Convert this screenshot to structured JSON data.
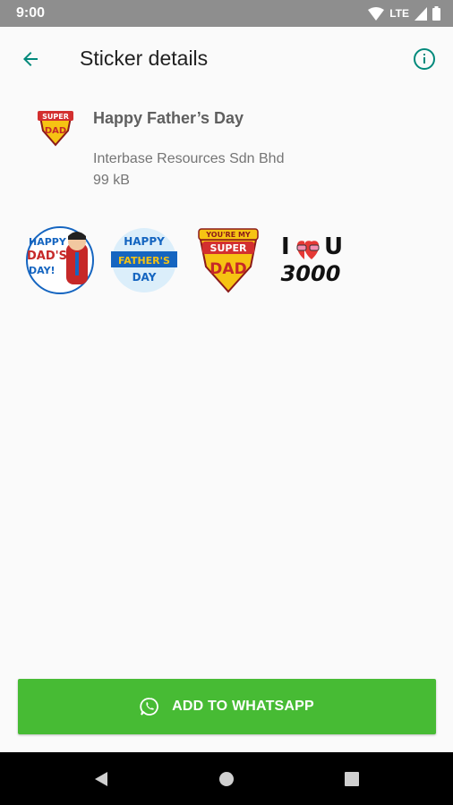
{
  "status_bar": {
    "time": "9:00",
    "network": "LTE"
  },
  "app_bar": {
    "title": "Sticker details",
    "back_icon": "arrow-back-icon",
    "info_icon": "info-icon"
  },
  "pack": {
    "title": "Happy Father’s Day",
    "publisher": "Interbase Resources Sdn Bhd",
    "size": "99 kB",
    "icon_text": [
      "SUPER",
      "DAD"
    ]
  },
  "stickers": [
    {
      "lines": [
        "HAPPY",
        "DAD'S",
        "DAY!"
      ]
    },
    {
      "lines": [
        "HAPPY",
        "FATHER'S",
        "DAY"
      ]
    },
    {
      "lines": [
        "YOU'RE MY",
        "SUPER",
        "DAD"
      ]
    },
    {
      "lines": [
        "I",
        "U",
        "3000"
      ]
    }
  ],
  "add_button": {
    "label": "ADD TO WHATSAPP",
    "icon": "whatsapp-icon"
  },
  "nav_bar": {
    "back": "back-triangle-icon",
    "home": "home-circle-icon",
    "recents": "recents-square-icon"
  },
  "colors": {
    "accent": "#00897b",
    "button": "#47bb34",
    "status_bar": "#8e8e8e"
  }
}
